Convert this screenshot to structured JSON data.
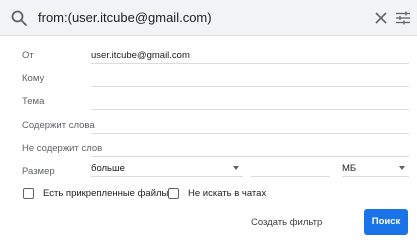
{
  "search": {
    "query": "from:(user.itcube@gmail.com)"
  },
  "icons": {
    "search": "search-icon",
    "clear": "close-icon",
    "options": "tune-icon"
  },
  "form": {
    "from_label": "От",
    "from_value": "user.itcube@gmail.com",
    "to_label": "Кому",
    "to_value": "",
    "subject_label": "Тема",
    "subject_value": "",
    "has_words_label": "Содержит слова",
    "has_words_value": "",
    "not_words_label": "Не содержит слов",
    "not_words_value": "",
    "size_label": "Размер",
    "size_operator": "больше",
    "size_value": "",
    "size_unit": "МБ",
    "has_attachment_label": "Есть прикрепленные файлы",
    "exclude_chats_label": "Не искать в чатах",
    "has_attachment_checked": false,
    "exclude_chats_checked": false
  },
  "actions": {
    "create_filter": "Создать фильтр",
    "search": "Поиск"
  },
  "colors": {
    "accent": "#1a73e8",
    "bar_background": "#f1f3f4"
  }
}
